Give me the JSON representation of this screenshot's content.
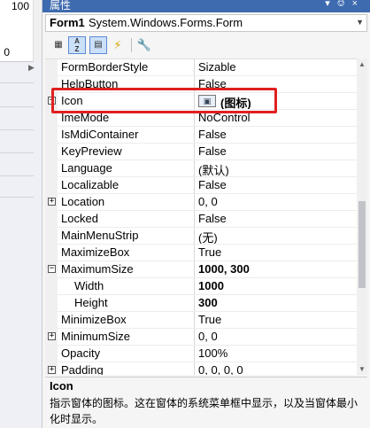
{
  "left": {
    "num_top": "100",
    "num_bottom": "0"
  },
  "panel": {
    "title": "属性"
  },
  "object": {
    "name": "Form1",
    "type": "System.Windows.Forms.Form"
  },
  "toolbar": {
    "categorized_icon": "categorized-icon",
    "alphabetical_icon": "alphabetical-icon",
    "properties_icon": "properties-icon",
    "events_icon": "lightning-icon",
    "property_pages_icon": "wrench-icon"
  },
  "rows": [
    {
      "name": "FormBorderStyle",
      "value": "Sizable"
    },
    {
      "name": "HelpButton",
      "value": "False"
    },
    {
      "name": "Icon",
      "value": "(图标)"
    },
    {
      "name": "ImeMode",
      "value": "NoControl"
    },
    {
      "name": "IsMdiContainer",
      "value": "False"
    },
    {
      "name": "KeyPreview",
      "value": "False"
    },
    {
      "name": "Language",
      "value": "(默认)"
    },
    {
      "name": "Localizable",
      "value": "False"
    },
    {
      "name": "Location",
      "value": "0, 0"
    },
    {
      "name": "Locked",
      "value": "False"
    },
    {
      "name": "MainMenuStrip",
      "value": "(无)"
    },
    {
      "name": "MaximizeBox",
      "value": "True"
    },
    {
      "name": "MaximumSize",
      "value": "1000, 300"
    },
    {
      "name": "Width",
      "value": "1000"
    },
    {
      "name": "Height",
      "value": "300"
    },
    {
      "name": "MinimizeBox",
      "value": "True"
    },
    {
      "name": "MinimumSize",
      "value": "0, 0"
    },
    {
      "name": "Opacity",
      "value": "100%"
    },
    {
      "name": "Padding",
      "value": "0, 0, 0, 0"
    }
  ],
  "description": {
    "title": "Icon",
    "text": "指示窗体的图标。这在窗体的系统菜单框中显示，以及当窗体最小化时显示。"
  }
}
